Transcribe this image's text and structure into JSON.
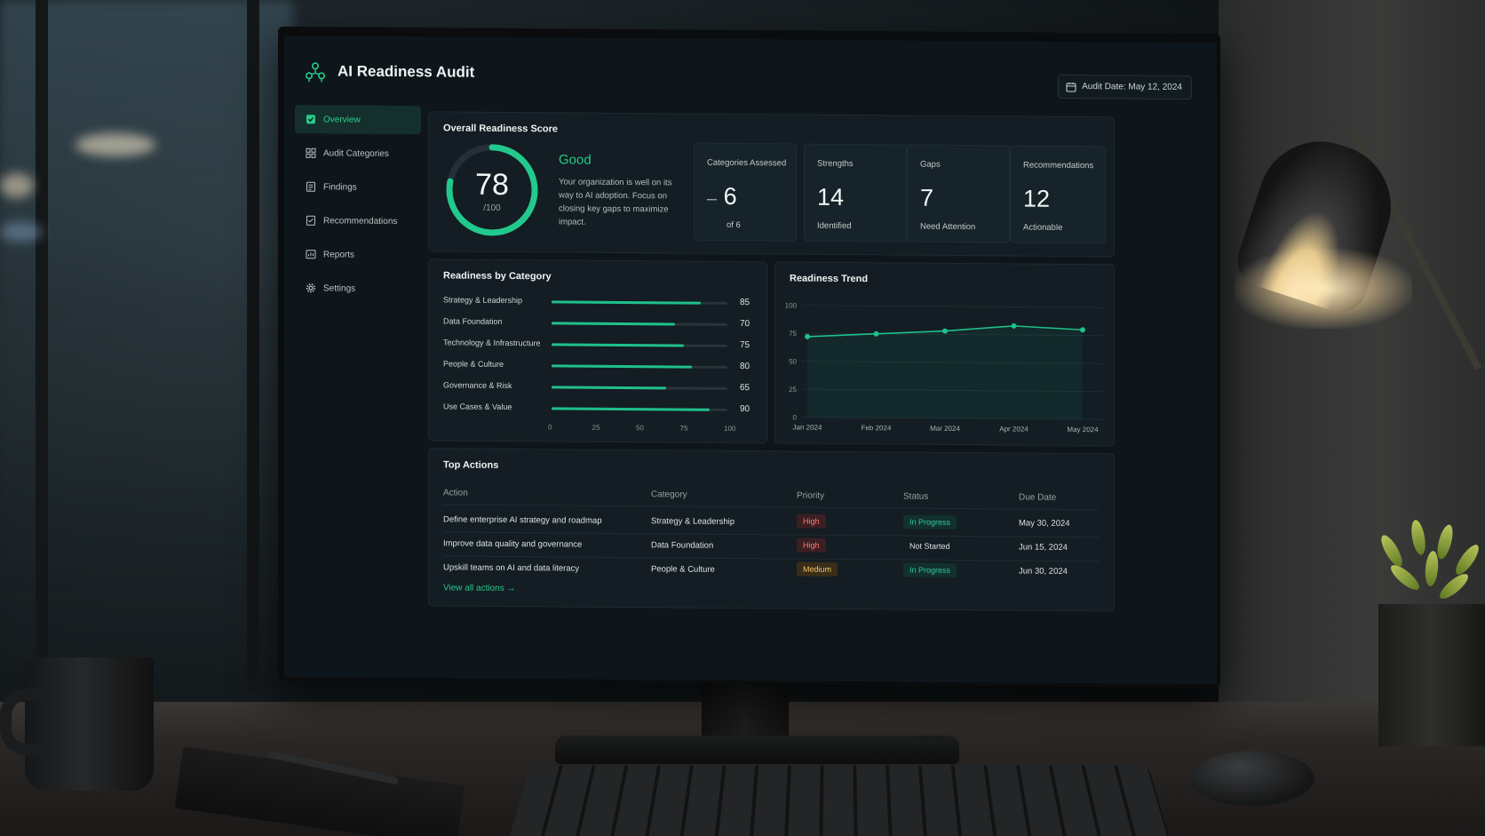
{
  "app": {
    "title": "AI Readiness Audit",
    "audit_date": "Audit Date: May 12, 2024"
  },
  "sidebar": {
    "items": [
      {
        "label": "Overview",
        "icon": "overview-icon",
        "active": true
      },
      {
        "label": "Audit Categories",
        "icon": "categories-icon",
        "active": false
      },
      {
        "label": "Findings",
        "icon": "findings-icon",
        "active": false
      },
      {
        "label": "Recommendations",
        "icon": "recommendations-icon",
        "active": false
      },
      {
        "label": "Reports",
        "icon": "reports-icon",
        "active": false
      },
      {
        "label": "Settings",
        "icon": "gear-icon",
        "active": false
      }
    ]
  },
  "overview": {
    "title": "Overall Readiness Score",
    "score": "78",
    "score_max": "/100",
    "score_fraction": 0.78,
    "rating": "Good",
    "description": "Your organization is well on its way to AI adoption. Focus on closing key gaps to maximize impact.",
    "stats": [
      {
        "label": "Categories Assessed",
        "value": "6",
        "prefix": "–",
        "sub": "of 6"
      },
      {
        "label": "Strengths",
        "value": "14",
        "prefix": "",
        "sub": "Identified"
      },
      {
        "label": "Gaps",
        "value": "7",
        "prefix": "",
        "sub": "Need Attention"
      },
      {
        "label": "Recommendations",
        "value": "12",
        "prefix": "",
        "sub": "Actionable"
      }
    ]
  },
  "categories": {
    "title": "Readiness by Category",
    "axis_ticks": [
      "0",
      "25",
      "50",
      "75",
      "100"
    ],
    "items": [
      {
        "name": "Strategy & Leadership",
        "value": 85
      },
      {
        "name": "Data Foundation",
        "value": 70
      },
      {
        "name": "Technology & Infrastructure",
        "value": 75
      },
      {
        "name": "People & Culture",
        "value": 80
      },
      {
        "name": "Governance & Risk",
        "value": 65
      },
      {
        "name": "Use Cases & Value",
        "value": 90
      }
    ]
  },
  "trend": {
    "title": "Readiness Trend"
  },
  "chart_data": {
    "type": "line",
    "title": "Readiness Trend",
    "x": [
      "Jan 2024",
      "Feb 2024",
      "Mar 2024",
      "Apr 2024",
      "May 2024"
    ],
    "series": [
      {
        "values": [
          72,
          75,
          78,
          83,
          80
        ]
      }
    ],
    "ylim": [
      0,
      100
    ],
    "y_ticks": [
      0,
      25,
      50,
      75,
      100
    ],
    "grid": true,
    "color": "#1fc08a"
  },
  "actions": {
    "title": "Top Actions",
    "columns": [
      "Action",
      "Category",
      "Priority",
      "Status",
      "Due Date"
    ],
    "rows": [
      {
        "action": "Define enterprise AI strategy and roadmap",
        "category": "Strategy & Leadership",
        "priority": "High",
        "status": "In Progress",
        "due": "May 30, 2024"
      },
      {
        "action": "Improve data quality and governance",
        "category": "Data Foundation",
        "priority": "High",
        "status": "Not Started",
        "due": "Jun 15, 2024"
      },
      {
        "action": "Upskill teams on AI and data literacy",
        "category": "People & Culture",
        "priority": "Medium",
        "status": "In Progress",
        "due": "Jun 30, 2024"
      }
    ],
    "view_all": "View all actions"
  },
  "colors": {
    "accent": "#27c98a",
    "background": "#0e161b",
    "card": "#131d23",
    "high": "#ff7b74",
    "medium": "#f0c36a"
  }
}
